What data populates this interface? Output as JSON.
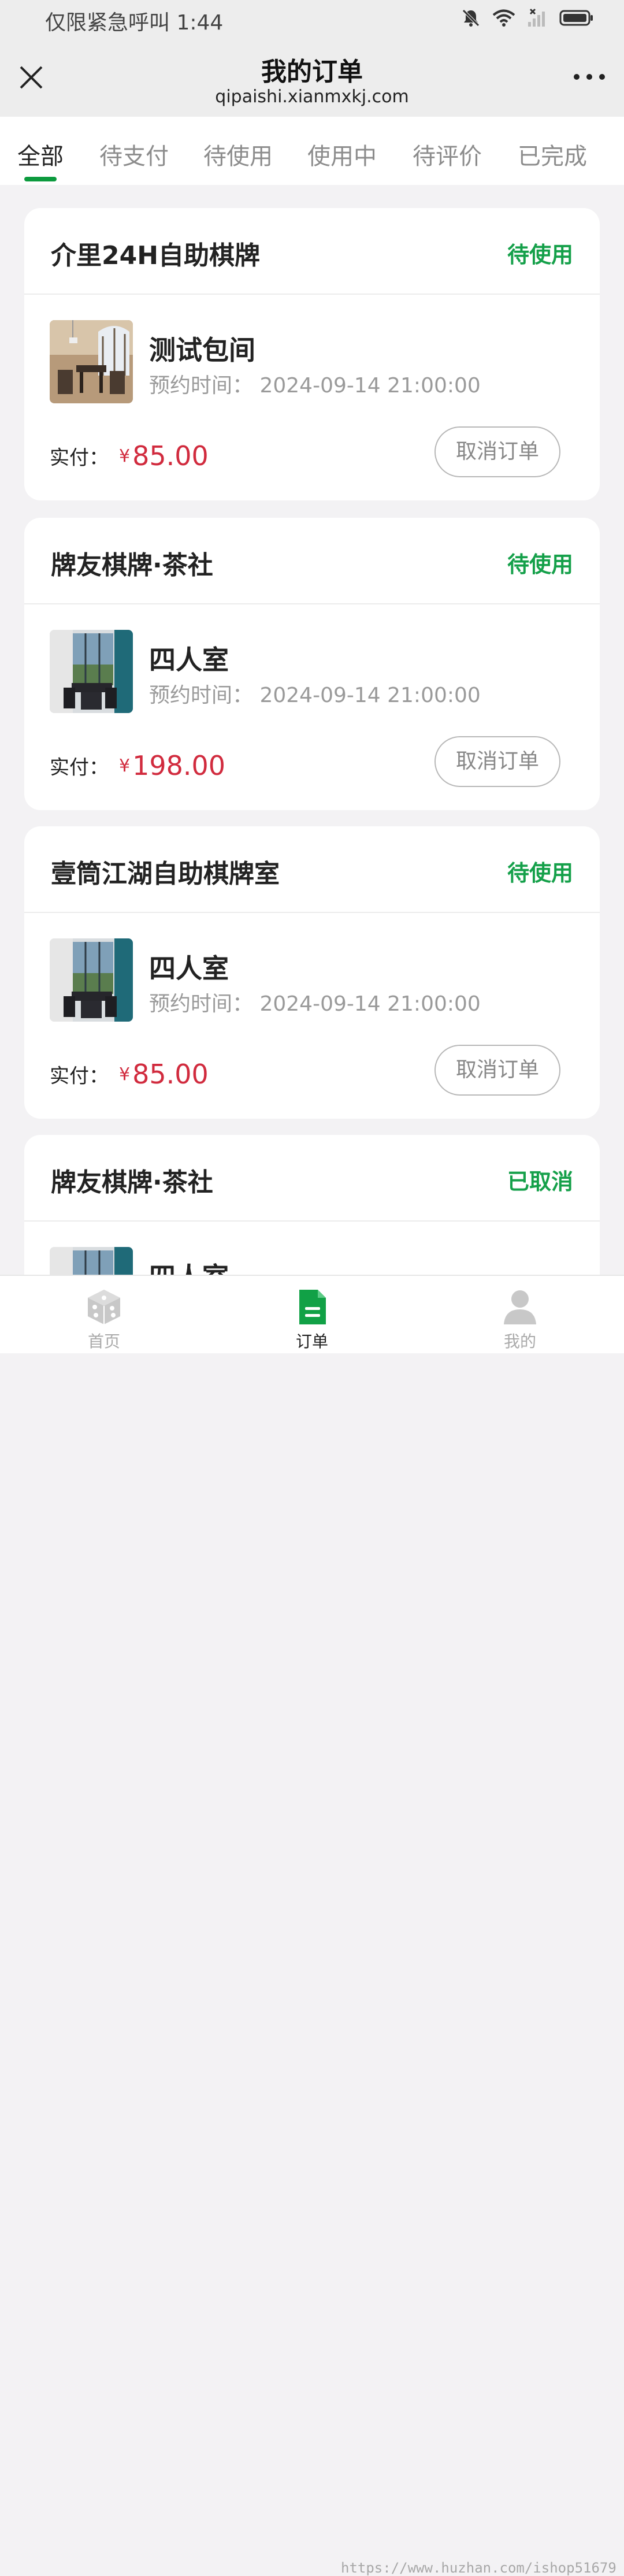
{
  "status_bar": {
    "text": "仅限紧急呼叫 1:44"
  },
  "nav": {
    "title": "我的订单",
    "subtitle": "qipaishi.xianmxkj.com"
  },
  "tabs": [
    {
      "label": "全部",
      "active": true
    },
    {
      "label": "待支付",
      "active": false
    },
    {
      "label": "待使用",
      "active": false
    },
    {
      "label": "使用中",
      "active": false
    },
    {
      "label": "待评价",
      "active": false
    },
    {
      "label": "已完成",
      "active": false
    }
  ],
  "orders": [
    {
      "shop": "介里24H自助棋牌",
      "status": "待使用",
      "room": "测试包间",
      "time_label": "预约时间：",
      "time": "2024-09-14 21:00:00",
      "paid_label": "实付：",
      "currency": "¥",
      "amount": "85.00",
      "cancel_label": "取消订单"
    },
    {
      "shop": "牌友棋牌·茶社",
      "status": "待使用",
      "room": "四人室",
      "time_label": "预约时间：",
      "time": "2024-09-14 21:00:00",
      "paid_label": "实付：",
      "currency": "¥",
      "amount": "198.00",
      "cancel_label": "取消订单"
    },
    {
      "shop": "壹筒江湖自助棋牌室",
      "status": "待使用",
      "room": "四人室",
      "time_label": "预约时间：",
      "time": "2024-09-14 21:00:00",
      "paid_label": "实付：",
      "currency": "¥",
      "amount": "85.00",
      "cancel_label": "取消订单"
    },
    {
      "shop": "牌友棋牌·茶社",
      "status": "已取消",
      "room": "四人室"
    }
  ],
  "bottom_nav": [
    {
      "label": "首页",
      "icon": "dice-icon",
      "active": false
    },
    {
      "label": "订单",
      "icon": "order-document-icon",
      "active": true
    },
    {
      "label": "我的",
      "icon": "user-icon",
      "active": false
    }
  ],
  "watermark": "https://www.huzhan.com/ishop51679",
  "colors": {
    "accent": "#15a04a",
    "price": "#d12b3e"
  }
}
